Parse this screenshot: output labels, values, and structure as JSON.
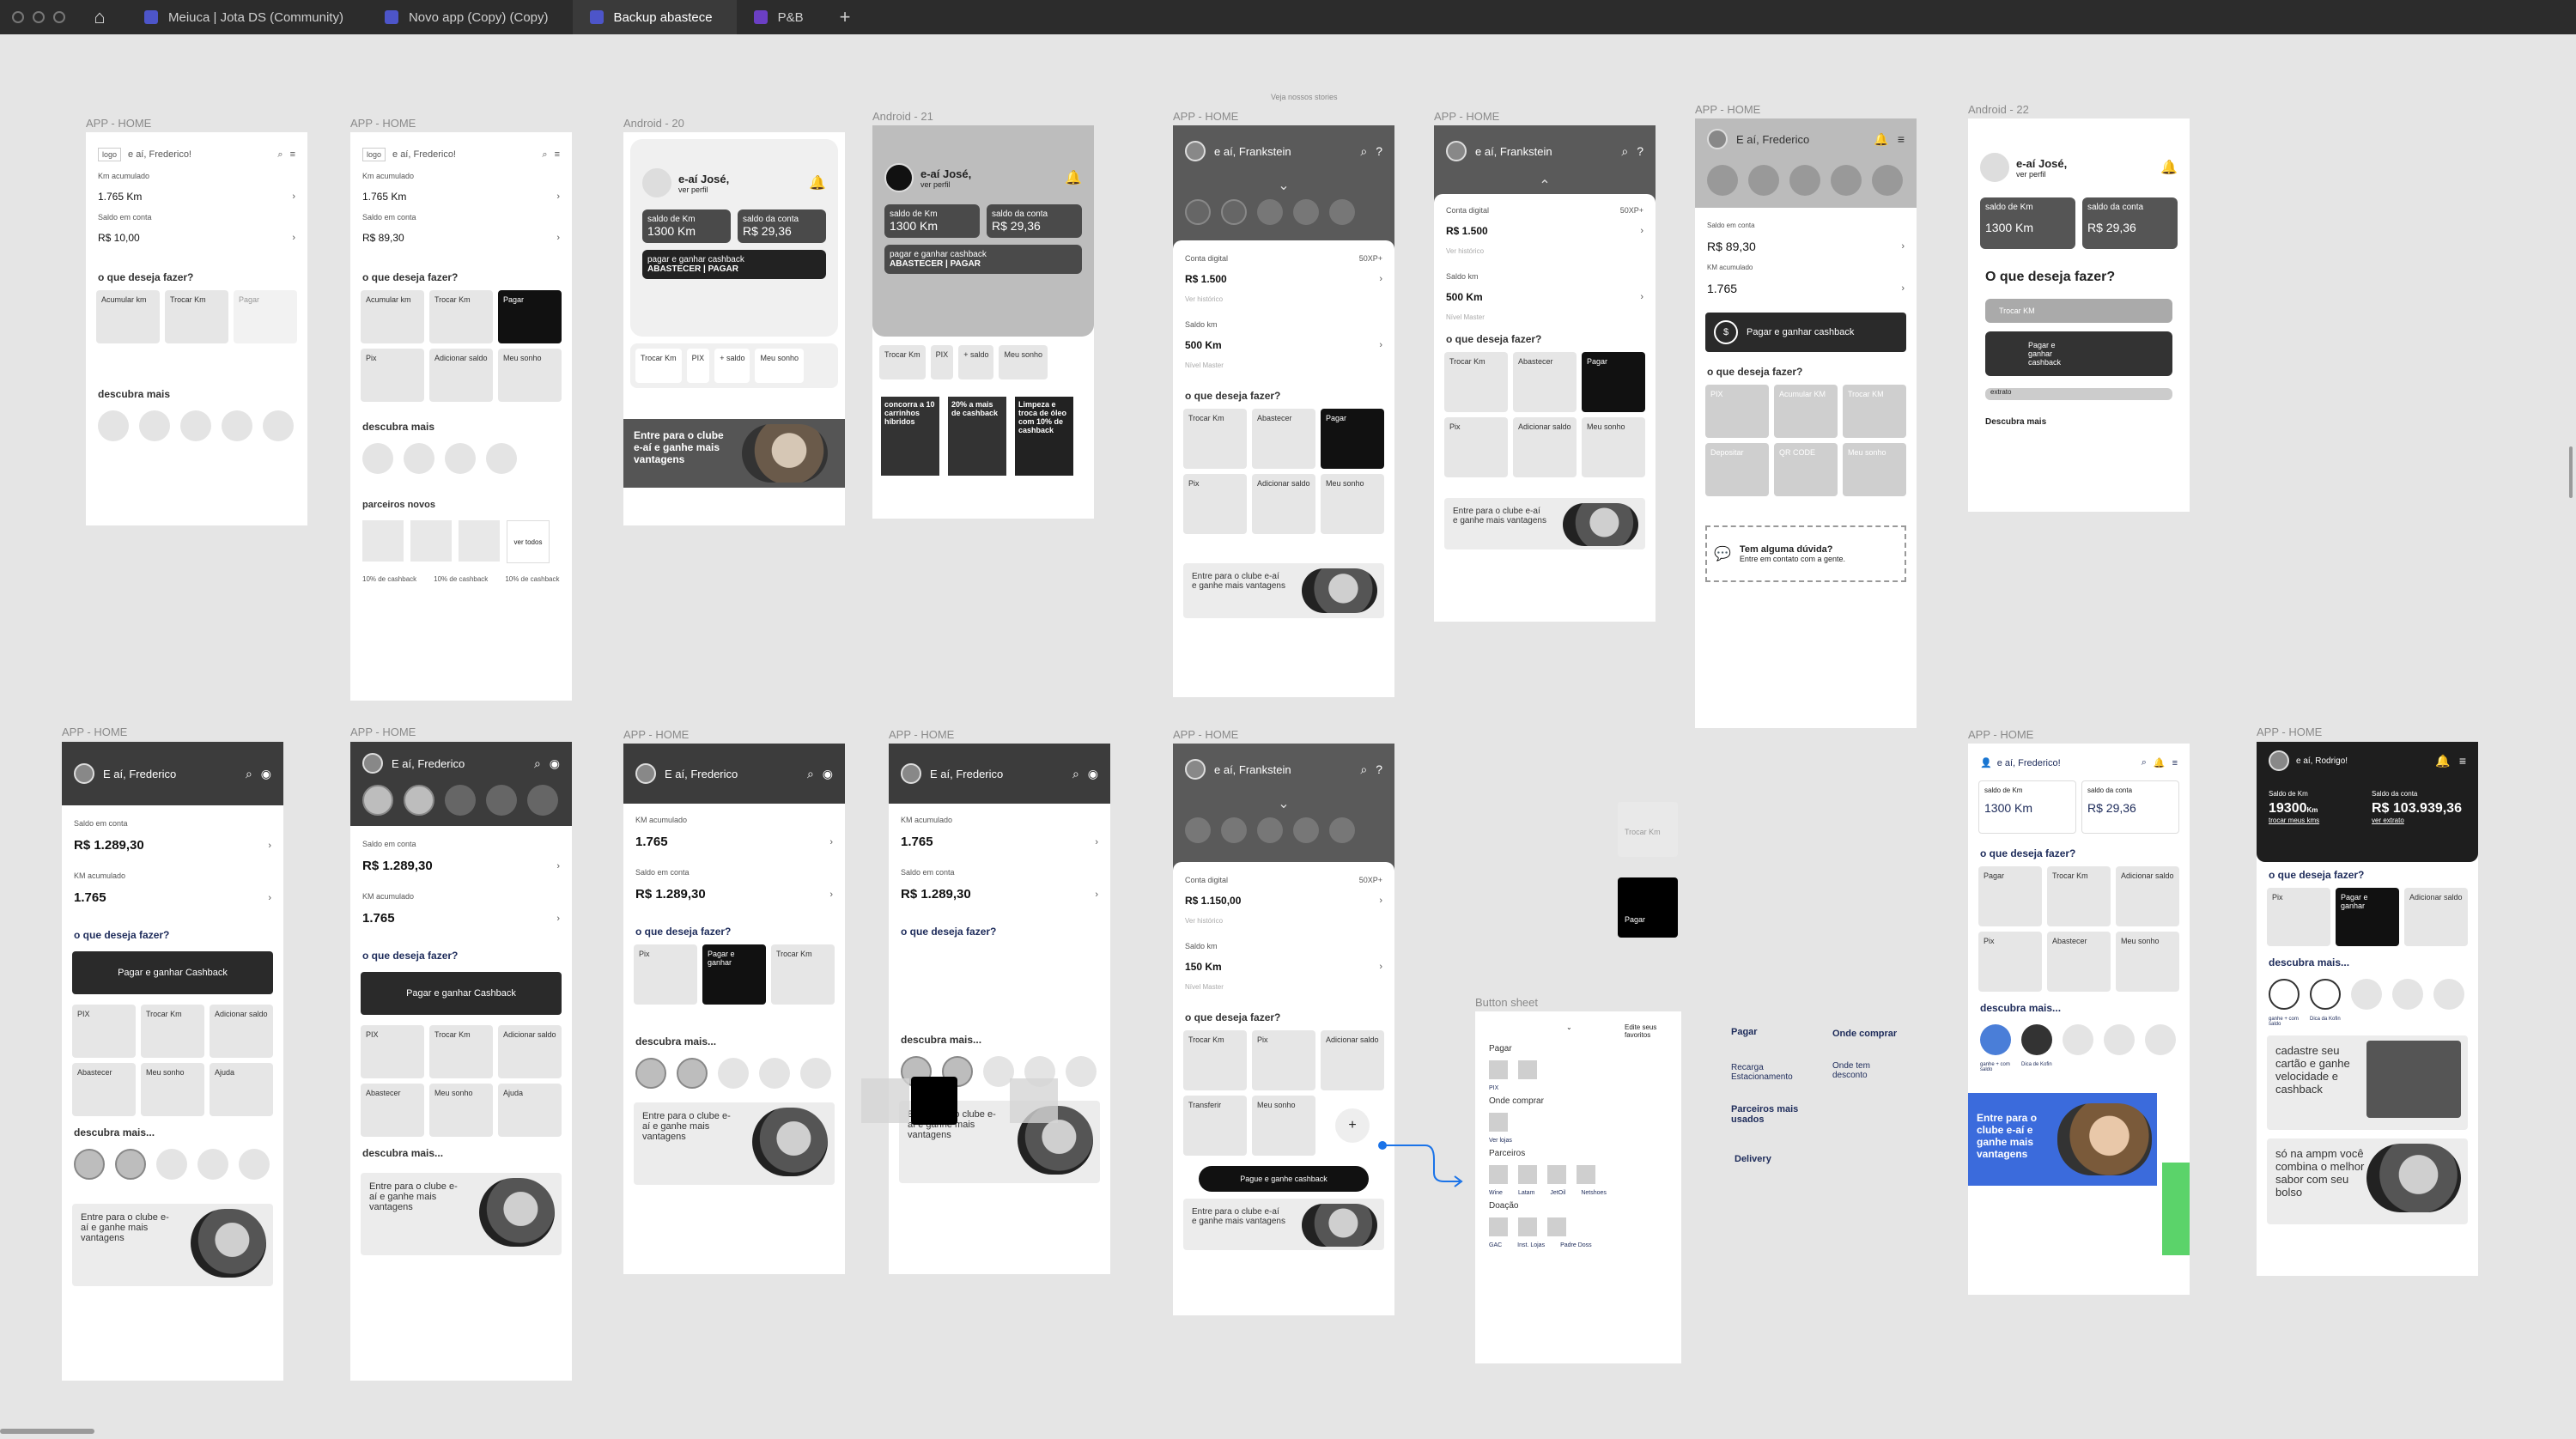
{
  "tabs": [
    {
      "label": "Meiuca | Jota DS (Community)"
    },
    {
      "label": "Novo app (Copy) (Copy)"
    },
    {
      "label": "Backup abastece"
    },
    {
      "label": "P&B"
    }
  ],
  "labels": {
    "app_home": "APP - HOME",
    "android20": "Android - 20",
    "android21": "Android - 21",
    "android22": "Android - 22",
    "veja": "Veja nossos stories",
    "button_sheet": "Button sheet"
  },
  "f1": {
    "logo": "logo",
    "greet": "e aí, Frederico!",
    "km_label": "Km acumulado",
    "km": "1.765 Km",
    "saldo_label": "Saldo em conta",
    "saldo": "R$ 10,00",
    "q": "o que deseja fazer?",
    "t1": "Acumular km",
    "t2": "Trocar Km",
    "t3": "Pagar",
    "desc": "descubra mais"
  },
  "f2": {
    "logo": "logo",
    "greet": "e aí, Frederico!",
    "km_label": "Km acumulado",
    "km": "1.765 Km",
    "saldo_label": "Saldo em conta",
    "saldo": "R$ 89,30",
    "q": "o que deseja fazer?",
    "t1": "Acumular km",
    "t2": "Trocar Km",
    "t3": "Pagar",
    "t4": "Pix",
    "t5": "Adicionar saldo",
    "t6": "Meu sonho",
    "desc": "descubra mais",
    "parc": "parceiros novos",
    "ver": "ver todos",
    "cb": "10% de cashback"
  },
  "f3": {
    "greet": "e-aí José,",
    "perfil": "ver perfil",
    "l1": "saldo de Km",
    "v1": "1300 Km",
    "l2": "saldo da conta",
    "v2": "R$ 29,36",
    "pagar_l": "pagar e ganhar cashback",
    "pagar": "ABASTECER | PAGAR",
    "a1": "Trocar Km",
    "a2": "PIX",
    "a3": "+ saldo",
    "a4": "Meu sonho",
    "banner": "Entre para o clube e-aí e ganhe mais vantagens"
  },
  "f4": {
    "greet": "e-aí José,",
    "perfil": "ver perfil",
    "l1": "saldo de Km",
    "v1": "1300 Km",
    "l2": "saldo da conta",
    "v2": "R$ 29,36",
    "pagar_l": "pagar e ganhar cashback",
    "pagar": "ABASTECER | PAGAR",
    "a1": "Trocar Km",
    "a2": "PIX",
    "a3": "+ saldo",
    "a4": "Meu sonho",
    "s1": "concorra a 10 carrinhos híbridos",
    "s2": "20% a mais de cashback",
    "s3": "Limpeza e troca de óleo com 10% de cashback"
  },
  "f5": {
    "greet": "e aí, Frankstein",
    "c1": "Conta digital",
    "v1": "R$ 1.500",
    "sub1": "Ver histórico",
    "badge": "50XP+",
    "c2": "Saldo km",
    "v2": "500 Km",
    "sub2": "Nível Master",
    "q": "o que deseja fazer?",
    "t1": "Trocar Km",
    "t2": "Abastecer",
    "t3": "Pagar",
    "t4": "Pix",
    "t5": "Adicionar saldo",
    "t6": "Meu sonho",
    "banner": "Entre para o clube e-aí e ganhe mais vantagens"
  },
  "f6": {
    "greet": "e aí, Frankstein",
    "c1": "Conta digital",
    "v1": "R$ 1.500",
    "sub1": "Ver histórico",
    "badge": "50XP+",
    "c2": "Saldo km",
    "v2": "500 Km",
    "sub2": "Nível Master",
    "q": "o que deseja fazer?",
    "t1": "Trocar Km",
    "t2": "Abastecer",
    "t3": "Pagar",
    "t4": "Pix",
    "t5": "Adicionar saldo",
    "t6": "Meu sonho",
    "banner": "Entre para o clube e-aí e ganhe mais vantagens"
  },
  "f7": {
    "greet": "E aí, Frederico",
    "saldo_l": "Saldo em conta",
    "saldo": "R$ 89,30",
    "km_l": "KM acumulado",
    "km": "1.765",
    "pagar": "Pagar e ganhar cashback",
    "q": "o que deseja fazer?",
    "t1": "PIX",
    "t2": "Acumular KM",
    "t3": "Trocar KM",
    "t4": "Depositar",
    "t5": "QR CODE",
    "t6": "Meu sonho",
    "duvida": "Tem alguma dúvida?",
    "contato": "Entre em contato com a gente."
  },
  "f8": {
    "greet": "e-aí José,",
    "perfil": "ver perfil",
    "l1": "saldo de Km",
    "v1": "1300 Km",
    "l2": "saldo da conta",
    "v2": "R$ 29,36",
    "q": "O que deseja fazer?",
    "trocar": "Trocar KM",
    "pagar": "Pagar e ganhar cashback",
    "extrato": "extrato",
    "desc": "Descubra mais"
  },
  "f9": {
    "greet": "E aí, Frederico",
    "saldo_l": "Saldo em conta",
    "saldo": "R$ 1.289,30",
    "km_l": "KM acumulado",
    "km": "1.765",
    "q": "o que deseja fazer?",
    "pagar": "Pagar e ganhar Cashback",
    "t1": "PIX",
    "t2": "Trocar Km",
    "t3": "Adicionar saldo",
    "t4": "Abastecer",
    "t5": "Meu sonho",
    "t6": "Ajuda",
    "desc": "descubra mais...",
    "banner": "Entre para o clube e-aí e ganhe mais vantagens"
  },
  "f10": {
    "greet": "E aí, Frederico",
    "saldo_l": "Saldo em conta",
    "saldo": "R$ 1.289,30",
    "km_l": "KM acumulado",
    "km": "1.765",
    "q": "o que deseja fazer?",
    "pagar": "Pagar e ganhar Cashback",
    "t1": "PIX",
    "t2": "Trocar Km",
    "t3": "Adicionar saldo",
    "t4": "Abastecer",
    "t5": "Meu sonho",
    "t6": "Ajuda",
    "desc": "descubra mais...",
    "banner": "Entre para o clube e-aí e ganhe mais vantagens"
  },
  "f11": {
    "greet": "E aí, Frederico",
    "km_l": "KM acumulado",
    "km": "1.765",
    "saldo_l": "Saldo em conta",
    "saldo": "R$ 1.289,30",
    "q": "o que deseja fazer?",
    "t1": "Pix",
    "t2": "Pagar e ganhar",
    "t3": "Trocar Km",
    "desc": "descubra mais...",
    "banner": "Entre para o clube e-aí e ganhe mais vantagens"
  },
  "f12": {
    "greet": "E aí, Frederico",
    "km_l": "KM acumulado",
    "km": "1.765",
    "saldo_l": "Saldo em conta",
    "saldo": "R$ 1.289,30",
    "q": "o que deseja fazer?",
    "desc": "descubra mais...",
    "banner": "Entre para o clube e-aí e ganhe mais vantagens"
  },
  "f13": {
    "greet": "e aí, Frankstein",
    "c1": "Conta digital",
    "v1": "R$ 1.150,00",
    "sub1": "Ver histórico",
    "badge": "50XP+",
    "c2": "Saldo km",
    "v2": "150 Km",
    "sub2": "Nível Master",
    "q": "o que deseja fazer?",
    "t1": "Trocar Km",
    "t2": "Pix",
    "t3": "Adicionar saldo",
    "t4": "Transferir",
    "t5": "Meu sonho",
    "pagar": "Pague e ganhe cashback",
    "banner": "Entre para o clube e-aí e ganhe mais vantagens"
  },
  "floating": {
    "trocar": "Trocar Km",
    "pagar": "Pagar"
  },
  "sheet": {
    "edit": "Edite seus favoritos",
    "pagar": "Pagar",
    "pix": "PIX",
    "onde": "Onde comprar",
    "verlojas": "Ver lojas",
    "parceiros": "Parceiros",
    "p1": "Wine",
    "p2": "Latam",
    "p3": "JetOil",
    "p4": "Netshoes",
    "doacao": "Doação",
    "d1": "GAC",
    "d2": "Inst. Lojas",
    "d3": "Padre Doss"
  },
  "notes": {
    "n1": "Pagar",
    "n2": "Onde comprar",
    "n3": "Recarga Estacionamento",
    "n4": "Onde tem desconto",
    "n5": "Parceiros mais usados",
    "n6": "Delivery"
  },
  "f14": {
    "greet": "e aí, Frederico!",
    "l1": "saldo de Km",
    "v1": "1300 Km",
    "l2": "saldo da conta",
    "v2": "R$ 29,36",
    "q": "o que deseja fazer?",
    "t1": "Pagar",
    "t2": "Trocar Km",
    "t3": "Adicionar saldo",
    "t4": "Pix",
    "t5": "Abastecer",
    "t6": "Meu sonho",
    "desc": "descubra mais...",
    "c1": "ganhe + com saldo",
    "c2": "Dica de Kofin",
    "banner": "Entre para o clube e-aí e ganhe mais vantagens"
  },
  "f15": {
    "greet": "e aí, Rodrigo!",
    "l1": "Saldo de Km",
    "v1": "19300",
    "u1": "Km",
    "sub1": "trocar meus kms",
    "l2": "Saldo da conta",
    "v2": "R$ 103.939,36",
    "sub2": "ver extrato",
    "q": "o que deseja fazer?",
    "t1": "Pix",
    "t2": "Pagar e ganhar",
    "t3": "Adicionar saldo",
    "desc": "descubra mais...",
    "c1": "ganhe + com saldo",
    "c2": "Dica da Kofin",
    "p1": "cadastre seu cartão e ganhe velocidade e cashback",
    "p2": "só na ampm você combina o melhor sabor com seu bolso"
  }
}
